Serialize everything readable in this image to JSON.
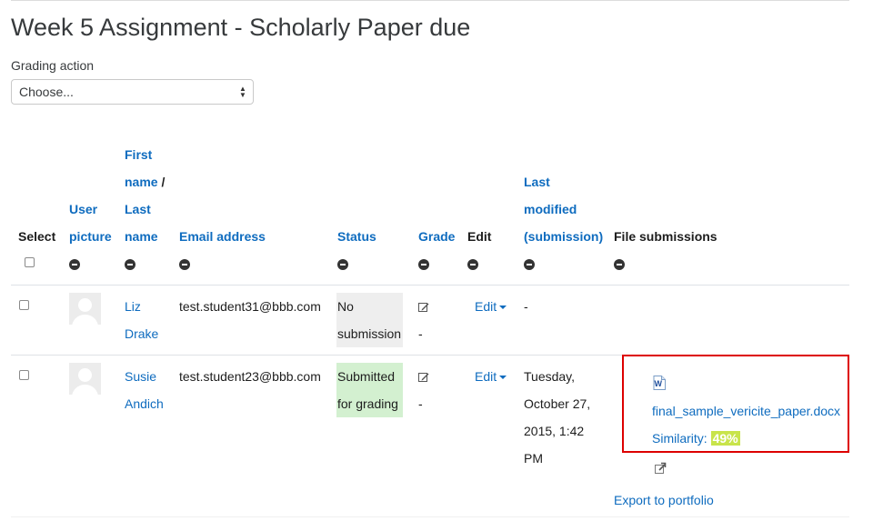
{
  "page": {
    "title": "Week 5 Assignment - Scholarly Paper due"
  },
  "grading": {
    "label": "Grading action",
    "selected": "Choose..."
  },
  "table": {
    "headers": {
      "select": "Select",
      "user_picture_1": "User",
      "user_picture_2": "picture",
      "first_name": "First",
      "name_slash_1": "name",
      "slash": " /",
      "last_1": "Last",
      "last_2": "name",
      "email": "Email address",
      "status": "Status",
      "grade": "Grade",
      "edit": "Edit",
      "last_modified_1": "Last",
      "last_modified_2": "modified",
      "last_modified_3": "(submission)",
      "file_submissions": "File submissions"
    },
    "rows": [
      {
        "first": "Liz",
        "last": "Drake",
        "email": "test.student31@bbb.com",
        "status_1": "No",
        "status_2": "submission",
        "grade": "-",
        "edit": "Edit",
        "modified": "-"
      },
      {
        "first": "Susie",
        "last": "Andich",
        "email": "test.student23@bbb.com",
        "status_1": "Submitted",
        "status_2": "for grading",
        "grade": "-",
        "edit": "Edit",
        "modified_1": "Tuesday,",
        "modified_2": "October 27,",
        "modified_3": "2015, 1:42",
        "modified_4": "PM",
        "file_name": "final_sample_vericite_paper.docx",
        "similarity_label": "Similarity:",
        "similarity_value": "49%",
        "export": "Export to portfolio"
      }
    ]
  },
  "colors": {
    "link": "#0f6cbf",
    "highlight": "#dd0000",
    "similarity": "#c8e44a",
    "submitted_bg": "#d3f0d0",
    "nosubmission_bg": "#eeeeee"
  },
  "icons": [
    "minus-circle-icon",
    "pencil-icon",
    "word-doc-icon",
    "export-icon",
    "caret-down-icon",
    "sort-arrows-icon"
  ]
}
